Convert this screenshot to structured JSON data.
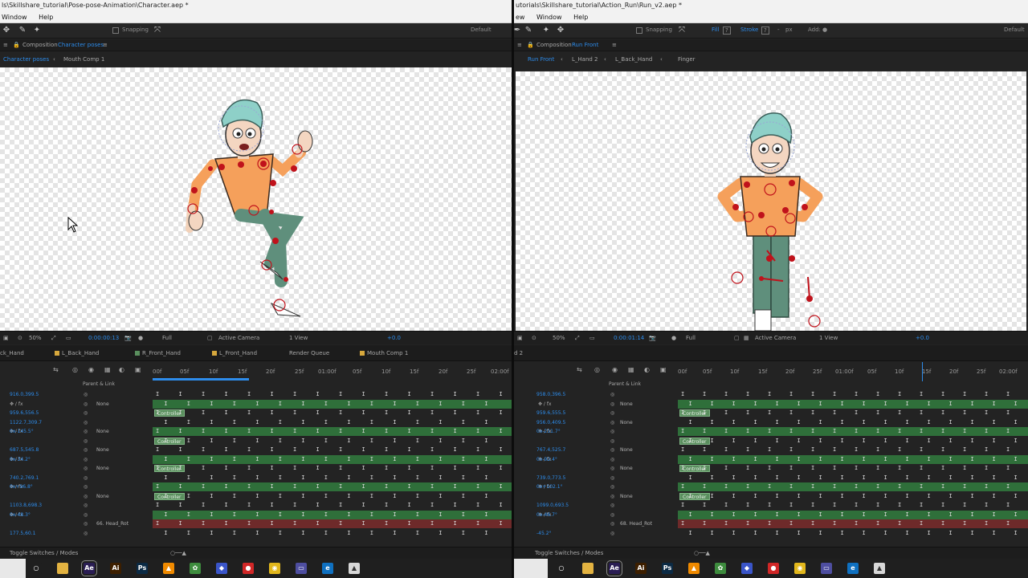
{
  "colors": {
    "accent": "#2d8ceb",
    "track_green": "#2f6f3a",
    "track_red": "#6e2a2a",
    "controller_tag": "#5a8f5e",
    "joint_red": "#c0121b",
    "shirt_orange": "#f5a05b",
    "pants_green": "#5f8f7c",
    "hair_teal": "#8ed0c8"
  },
  "left": {
    "title": "ls\\Skillshare_tutorial\\Pose-pose-Animation\\Character.aep *",
    "menu": [
      "Window",
      "Help"
    ],
    "toolbar": {
      "snapping": "Snapping",
      "workspace": "Default"
    },
    "panel_header": {
      "label": "Composition",
      "comp": "Character poses"
    },
    "comp_tabs": [
      "Character poses",
      "Mouth Comp 1"
    ],
    "viewer_bar": {
      "zoom": "50%",
      "timecode": "0:00:00:13",
      "resolution": "Full",
      "camera": "Active Camera",
      "views": "1 View",
      "exposure": "+0.0"
    },
    "timeline_tabs": [
      "ck_Hand",
      "L_Back_Hand",
      "R_Front_Hand",
      "L_Front_Hand",
      "Render Queue",
      "Mouth Comp 1"
    ],
    "ruler_labels": [
      "00f",
      "05f",
      "10f",
      "15f",
      "20f",
      "25f",
      "01:00f",
      "05f",
      "10f",
      "15f",
      "20f",
      "25f",
      "02:00f"
    ],
    "parent_header": "Parent & Link",
    "layers": [
      {
        "value": "916.0,399.5",
        "parent": ""
      },
      {
        "value": "",
        "parent": "None"
      },
      {
        "value": "959.6,556.5",
        "parent": ""
      },
      {
        "value": "1122.7,309.7",
        "parent": ""
      },
      {
        "value": "0x-145.5°",
        "parent": "None"
      },
      {
        "value": "",
        "parent": ""
      },
      {
        "value": "687.5,545.8",
        "parent": "None"
      },
      {
        "value": "0x-34.2°",
        "parent": ""
      },
      {
        "value": "",
        "parent": "None"
      },
      {
        "value": "740.2,769.1",
        "parent": ""
      },
      {
        "value": "0x+96.8°",
        "parent": ""
      },
      {
        "value": "",
        "parent": "None"
      },
      {
        "value": "1103.8,698.3",
        "parent": ""
      },
      {
        "value": "0x-48.3°",
        "parent": ""
      },
      {
        "value": "",
        "parent": "66. Head_Rot"
      },
      {
        "value": "177.5,60.1",
        "parent": ""
      }
    ],
    "controller_label": "Controller",
    "footer": "Toggle Switches / Modes"
  },
  "right": {
    "title": "utorials\\Skillshare_tutorial\\Action_Run\\Run_v2.aep *",
    "menu": [
      "ew",
      "Window",
      "Help"
    ],
    "toolbar": {
      "snapping": "Snapping",
      "fill": "Fill",
      "stroke": "Stroke",
      "px": "px",
      "add": "Add:",
      "workspace": "Default"
    },
    "panel_header": {
      "label": "Composition",
      "comp": "Run Front"
    },
    "comp_tabs": [
      "Run Front",
      "L_Hand 2",
      "L_Back_Hand",
      "Finger"
    ],
    "viewer_bar": {
      "zoom": "50%",
      "timecode": "0:00:01:14",
      "resolution": "Full",
      "camera": "Active Camera",
      "views": "1 View",
      "exposure": "+0.0"
    },
    "timeline_tabs": [
      "d 2"
    ],
    "ruler_labels": [
      "00f",
      "05f",
      "10f",
      "15f",
      "20f",
      "25f",
      "01:00f",
      "05f",
      "10f",
      "15f",
      "20f",
      "25f",
      "02:00f"
    ],
    "parent_header": "Parent & Link",
    "layers": [
      {
        "value": "958.0,396.5",
        "parent": ""
      },
      {
        "value": "",
        "parent": "None"
      },
      {
        "value": "959.6,555.5",
        "parent": ""
      },
      {
        "value": "956.0,409.5",
        "parent": "None"
      },
      {
        "value": "0x-211.7°",
        "parent": ""
      },
      {
        "value": "",
        "parent": ""
      },
      {
        "value": "767.4,525.7",
        "parent": "None"
      },
      {
        "value": "0x-92.4°",
        "parent": ""
      },
      {
        "value": "",
        "parent": "None"
      },
      {
        "value": "739.0,773.5",
        "parent": ""
      },
      {
        "value": "0x+102.1°",
        "parent": ""
      },
      {
        "value": "",
        "parent": "None"
      },
      {
        "value": "1099.0,693.5",
        "parent": ""
      },
      {
        "value": "0x-46.7°",
        "parent": ""
      },
      {
        "value": "",
        "parent": "68. Head_Rot"
      },
      {
        "value": "-45.2°",
        "parent": ""
      }
    ],
    "controller_label": "Controller",
    "footer": "Toggle Switches / Modes"
  },
  "taskbar_icons": [
    "cortana-icon",
    "file-explorer-icon",
    "after-effects-icon",
    "illustrator-icon",
    "photoshop-icon",
    "vlc-icon",
    "settings-icon",
    "unity-icon",
    "screen-recorder-icon",
    "chrome-icon",
    "display-icon",
    "edge-icon",
    "photos-icon"
  ]
}
